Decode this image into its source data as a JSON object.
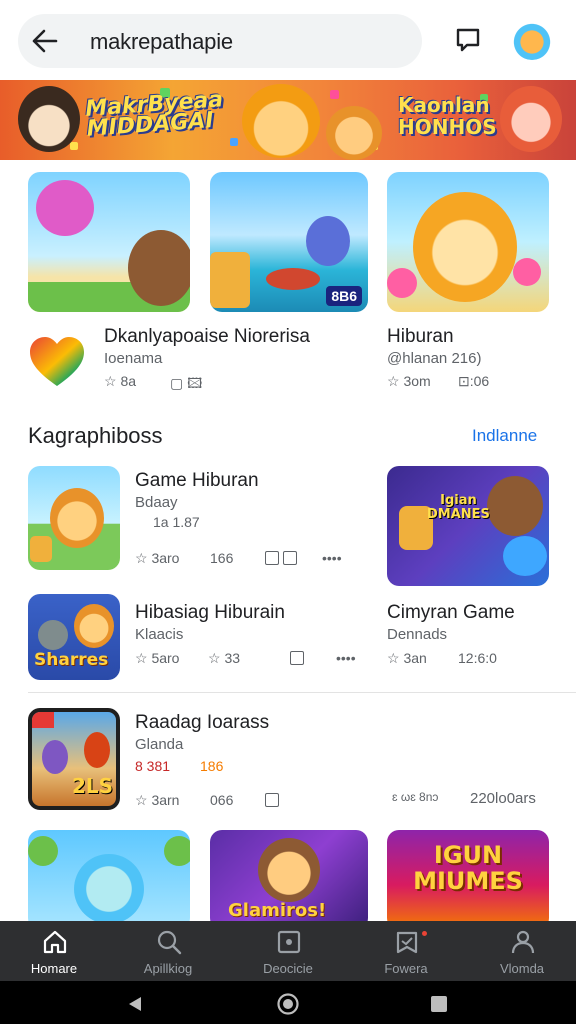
{
  "search": {
    "query": "makrepathapie"
  },
  "banner": {
    "left_text_line1": "MakrByeaa",
    "left_text_line2": "MIDDAGAI",
    "right_text_line1": "Kaonlan",
    "right_text_line2": "HONHOS"
  },
  "featured": [
    {
      "title": "Dkanlyapoaise Niorerisa",
      "subtitle": "Ioenama",
      "rating": "☆ 8a",
      "extra": "▢ 🖾"
    },
    {
      "title": "Hiburan",
      "subtitle": "@hlanan 216)",
      "rating": "☆ 3om",
      "extra": "⊡:06"
    }
  ],
  "thumb_badges": {
    "third": "8B6"
  },
  "section": {
    "title": "Kagraphiboss",
    "link": "Indlanne"
  },
  "list": [
    {
      "title": "Game Hiburan",
      "subtitle": "Bdaay",
      "line3": "1a  1.87",
      "rating": "☆ 3aro",
      "size": "166",
      "more": "••••"
    },
    {
      "title": "Hibasiag Hiburain",
      "subtitle": "Klaacis",
      "thumb_text": "Sharres",
      "rating": "☆ 5aro",
      "size": "☆ 33",
      "more": "••••"
    },
    {
      "title": "Raadag Ioarass",
      "subtitle": "Glanda",
      "line3": "8 381",
      "line3_accent": "186",
      "thumb_text": "2LS",
      "rating": "☆ 3arn",
      "size": "066",
      "right_note": "ɛ ωɛ 8nɔ",
      "right_value": "220lo0ars"
    }
  ],
  "side_cards": [
    {
      "thumb_text_line1": "Igian",
      "thumb_text_line2": "DMANES"
    },
    {
      "title": "Cimyran Game",
      "subtitle": "Dennads",
      "rating": "☆ 3an",
      "time": "12:6:0"
    }
  ],
  "bottom_thumbs": [
    {
      "text": ""
    },
    {
      "text": "Glamiros!"
    },
    {
      "text_line1": "IGUN",
      "text_line2": "MIUMES"
    }
  ],
  "nav": [
    {
      "label": "Homare",
      "icon": "home-icon"
    },
    {
      "label": "Apillkiog",
      "icon": "search-icon"
    },
    {
      "label": "Deocicie",
      "icon": "image-icon"
    },
    {
      "label": "Fowera",
      "icon": "bookmark-icon"
    },
    {
      "label": "Vlomda",
      "icon": "person-icon"
    }
  ],
  "colors": {
    "accent": "#1a73e8",
    "nav_bg": "#2e2f31",
    "banner_orange": "#f4a534"
  }
}
